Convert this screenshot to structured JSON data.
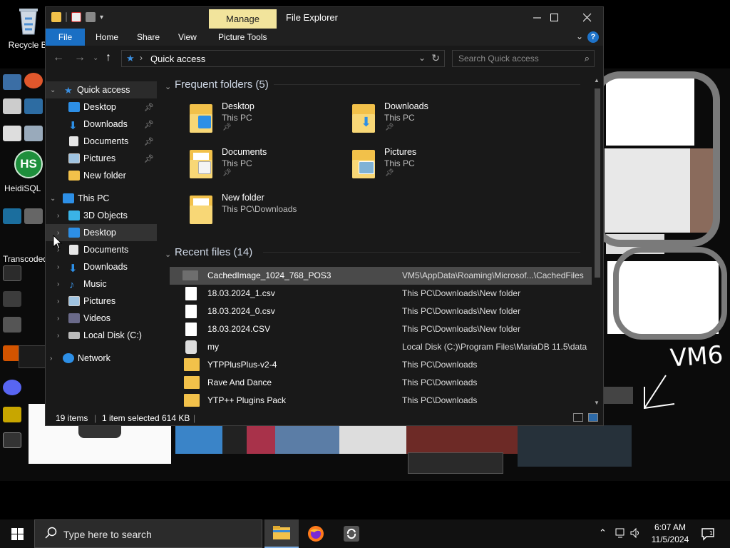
{
  "desktop": {
    "recycle_bin_label": "Recycle Bi",
    "heidisql_label": "HeidiSQL",
    "transcoded_label": "Transcoded",
    "hs_badge": "HS",
    "vm_text": "VM6"
  },
  "explorer": {
    "manage_tab": "Manage",
    "title": "File Explorer",
    "ribbon_tabs": [
      "File",
      "Home",
      "Share",
      "View",
      "Picture Tools"
    ],
    "breadcrumb": "Quick access",
    "search_placeholder": "Search Quick access",
    "nav": {
      "quick_access": "Quick access",
      "quick_items": [
        "Desktop",
        "Downloads",
        "Documents",
        "Pictures",
        "New folder"
      ],
      "this_pc": "This PC",
      "pc_items": [
        "3D Objects",
        "Desktop",
        "Documents",
        "Downloads",
        "Music",
        "Pictures",
        "Videos",
        "Local Disk (C:)"
      ],
      "network": "Network"
    },
    "frequent_title": "Frequent folders (5)",
    "frequent": [
      {
        "name": "Desktop",
        "loc": "This PC",
        "icon": "desktop-folder-icon"
      },
      {
        "name": "Downloads",
        "loc": "This PC",
        "icon": "downloads-folder-icon"
      },
      {
        "name": "Documents",
        "loc": "This PC",
        "icon": "documents-folder-icon"
      },
      {
        "name": "Pictures",
        "loc": "This PC",
        "icon": "pictures-folder-icon"
      },
      {
        "name": "New folder",
        "loc": "This PC\\Downloads",
        "icon": "folder-icon"
      }
    ],
    "recent_title": "Recent files (14)",
    "recent": [
      {
        "name": "CachedImage_1024_768_POS3",
        "path": "VM5\\AppData\\Roaming\\Microsof...\\CachedFiles",
        "icon": "image"
      },
      {
        "name": "18.03.2024_1.csv",
        "path": "This PC\\Downloads\\New folder",
        "icon": "file"
      },
      {
        "name": "18.03.2024_0.csv",
        "path": "This PC\\Downloads\\New folder",
        "icon": "file"
      },
      {
        "name": "18.03.2024.CSV",
        "path": "This PC\\Downloads\\New folder",
        "icon": "file"
      },
      {
        "name": "my",
        "path": "Local Disk (C:)\\Program Files\\MariaDB 11.5\\data",
        "icon": "gear"
      },
      {
        "name": "YTPPlusPlus-v2-4",
        "path": "This PC\\Downloads",
        "icon": "zip"
      },
      {
        "name": "Rave And Dance",
        "path": "This PC\\Downloads",
        "icon": "zip"
      },
      {
        "name": "YTP++ Plugins Pack",
        "path": "This PC\\Downloads",
        "icon": "zip"
      }
    ],
    "status": {
      "items": "19 items",
      "selected": "1 item selected",
      "size": "614 KB"
    }
  },
  "taskbar": {
    "search_placeholder": "Type here to search",
    "time": "6:07 AM",
    "date": "11/5/2024"
  }
}
